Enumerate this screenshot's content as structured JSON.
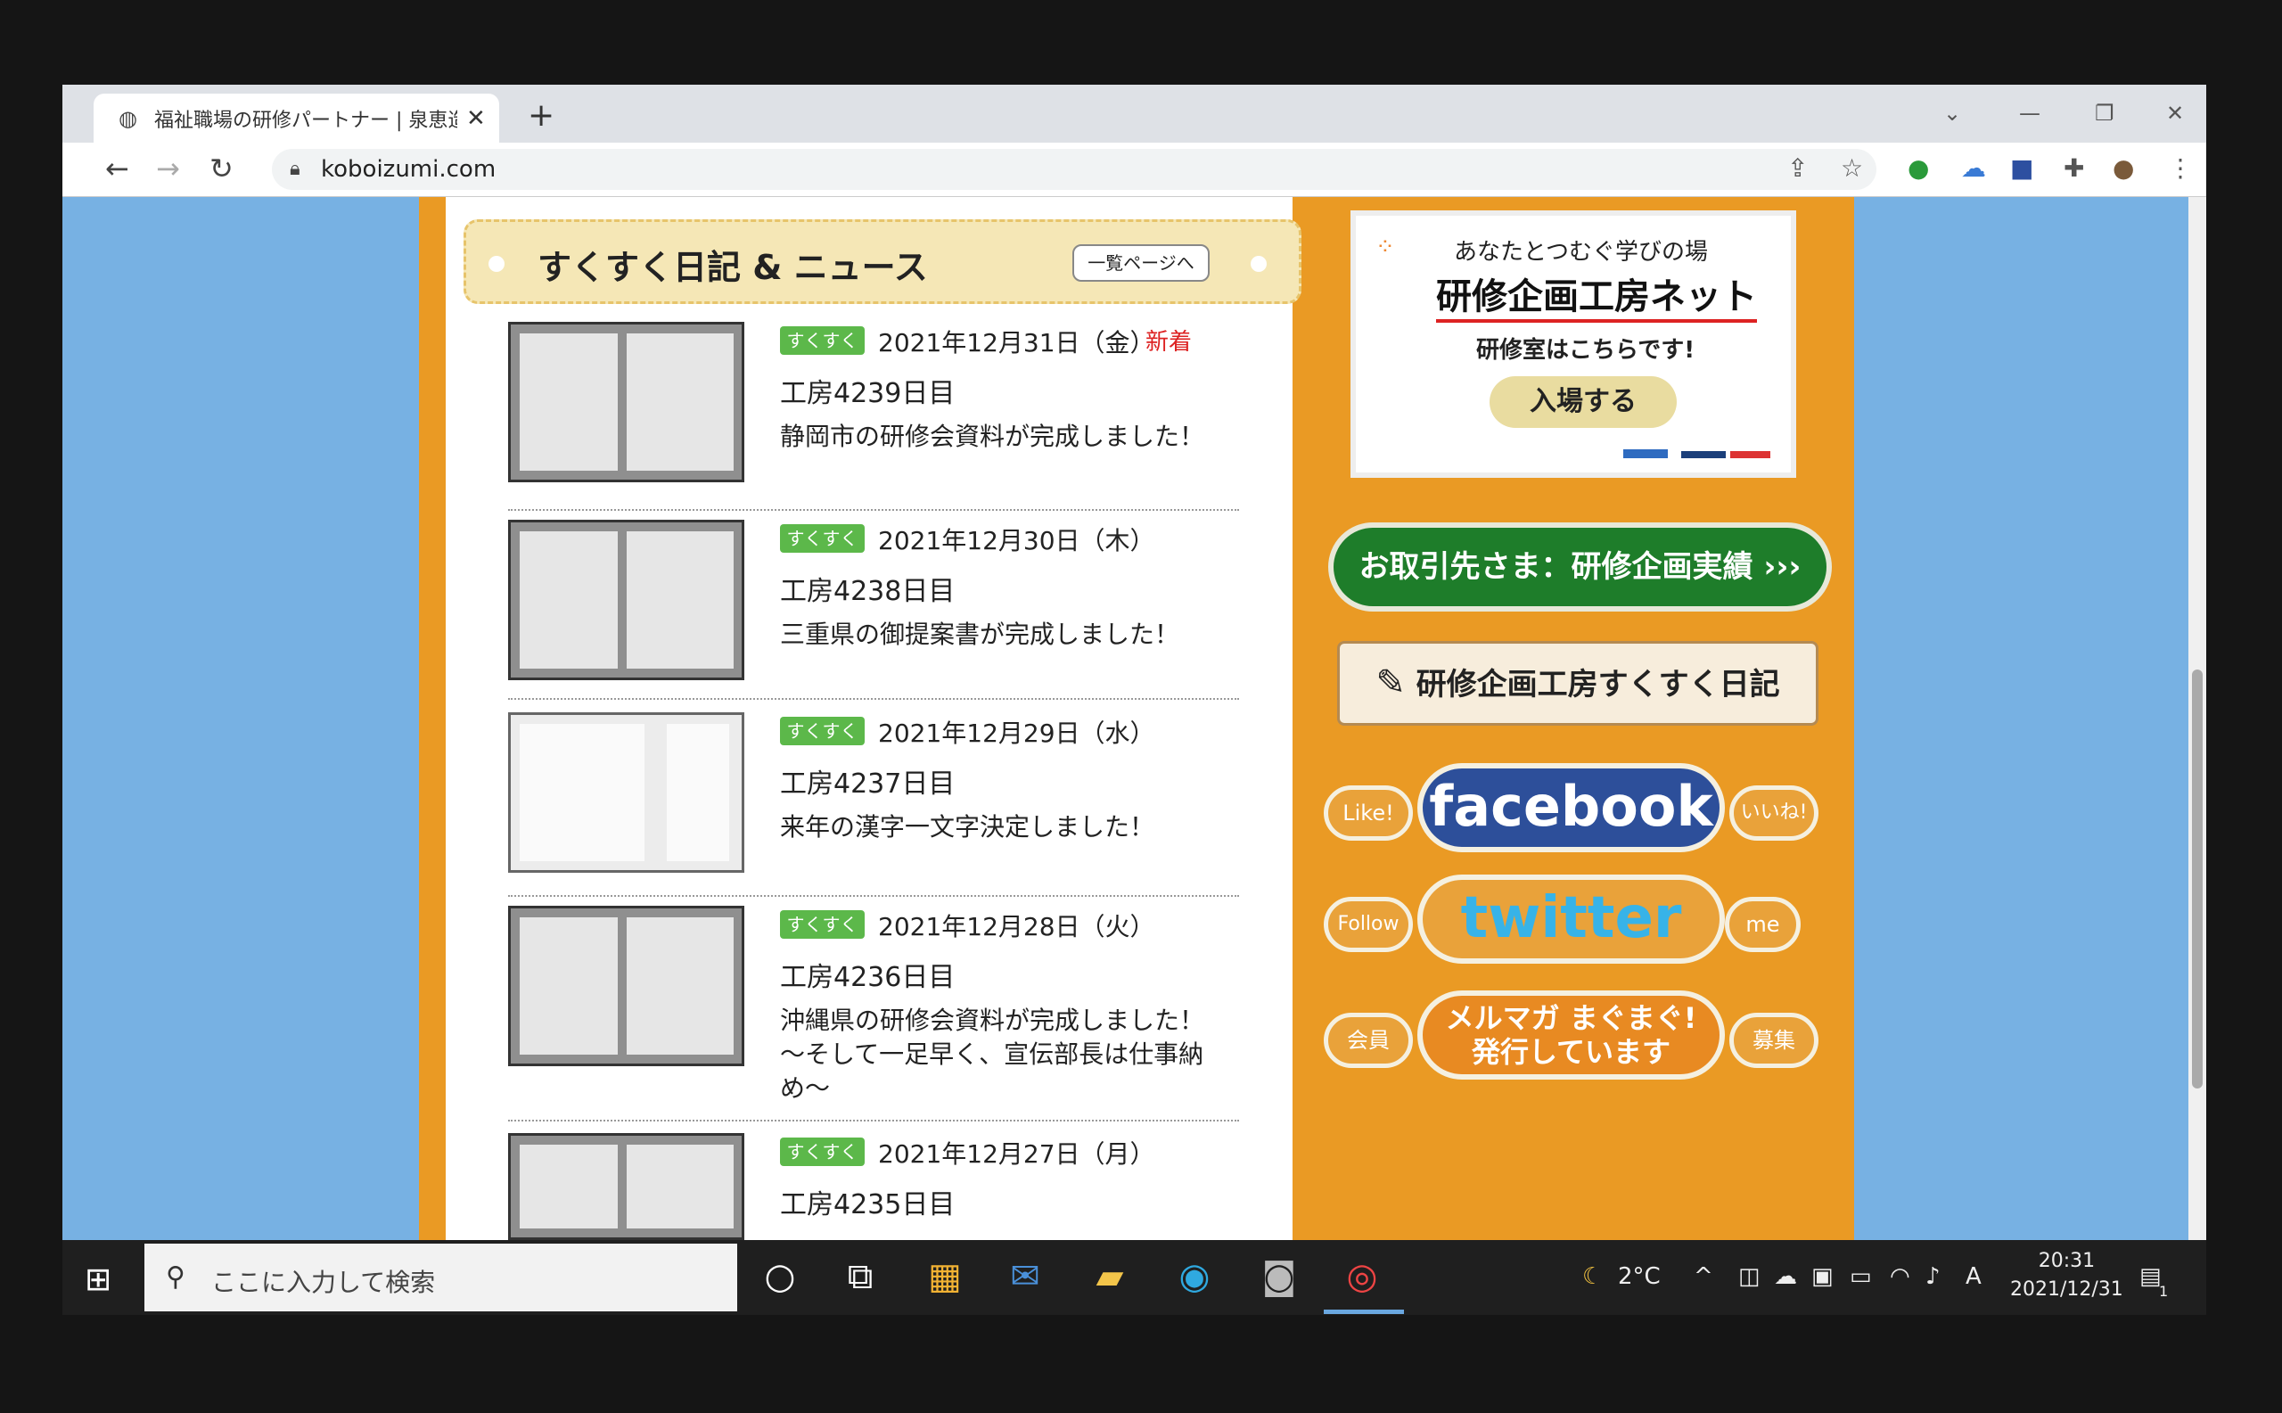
{
  "browser": {
    "tab_title": "福祉職場の研修パートナー | 泉恵造",
    "tab_close": "✕",
    "new_tab": "+",
    "url": "koboizumi.com"
  },
  "news": {
    "heading": "すくすく日記 & ニュース",
    "list_link": "一覧ページへ",
    "items": [
      {
        "tag": "すくすく",
        "date": "2021年12月31日（金）",
        "badge": "新着",
        "day": "工房4239日目",
        "desc": "静岡市の研修会資料が完成しました！"
      },
      {
        "tag": "すくすく",
        "date": "2021年12月30日（木）",
        "badge": "",
        "day": "工房4238日目",
        "desc": "三重県の御提案書が完成しました！"
      },
      {
        "tag": "すくすく",
        "date": "2021年12月29日（水）",
        "badge": "",
        "day": "工房4237日目",
        "desc": "来年の漢字一文字決定しました！"
      },
      {
        "tag": "すくすく",
        "date": "2021年12月28日（火）",
        "badge": "",
        "day": "工房4236日目",
        "desc": "沖縄県の研修会資料が完成しました！～そして一足早く、宣伝部長は仕事納め～"
      },
      {
        "tag": "すくすく",
        "date": "2021年12月27日（月）",
        "badge": "",
        "day": "工房4235日目",
        "desc": ""
      }
    ]
  },
  "sidebar": {
    "promo_sub": "あなたとつむぐ学びの場",
    "promo_main": "研修企画工房ネット",
    "promo_here": "研修室はこちらです!",
    "promo_enter": "入場する",
    "green_button": "お取引先さま：研修企画実績 ›››",
    "diary_button": "研修企画工房すくすく日記",
    "fb_left": "Like!",
    "fb_main": "facebook",
    "fb_right": "いいね!",
    "tw_left": "Follow",
    "tw_main": "twitter",
    "tw_right": "me",
    "mm_left": "会員",
    "mm_main_1": "メルマガ まぐまぐ!",
    "mm_main_2": "発行しています",
    "mm_right": "募集"
  },
  "taskbar": {
    "search_placeholder": "ここに入力して検索",
    "weather": "2°C",
    "ime": "A",
    "time": "20:31",
    "date": "2021/12/31",
    "notifications": "1"
  }
}
